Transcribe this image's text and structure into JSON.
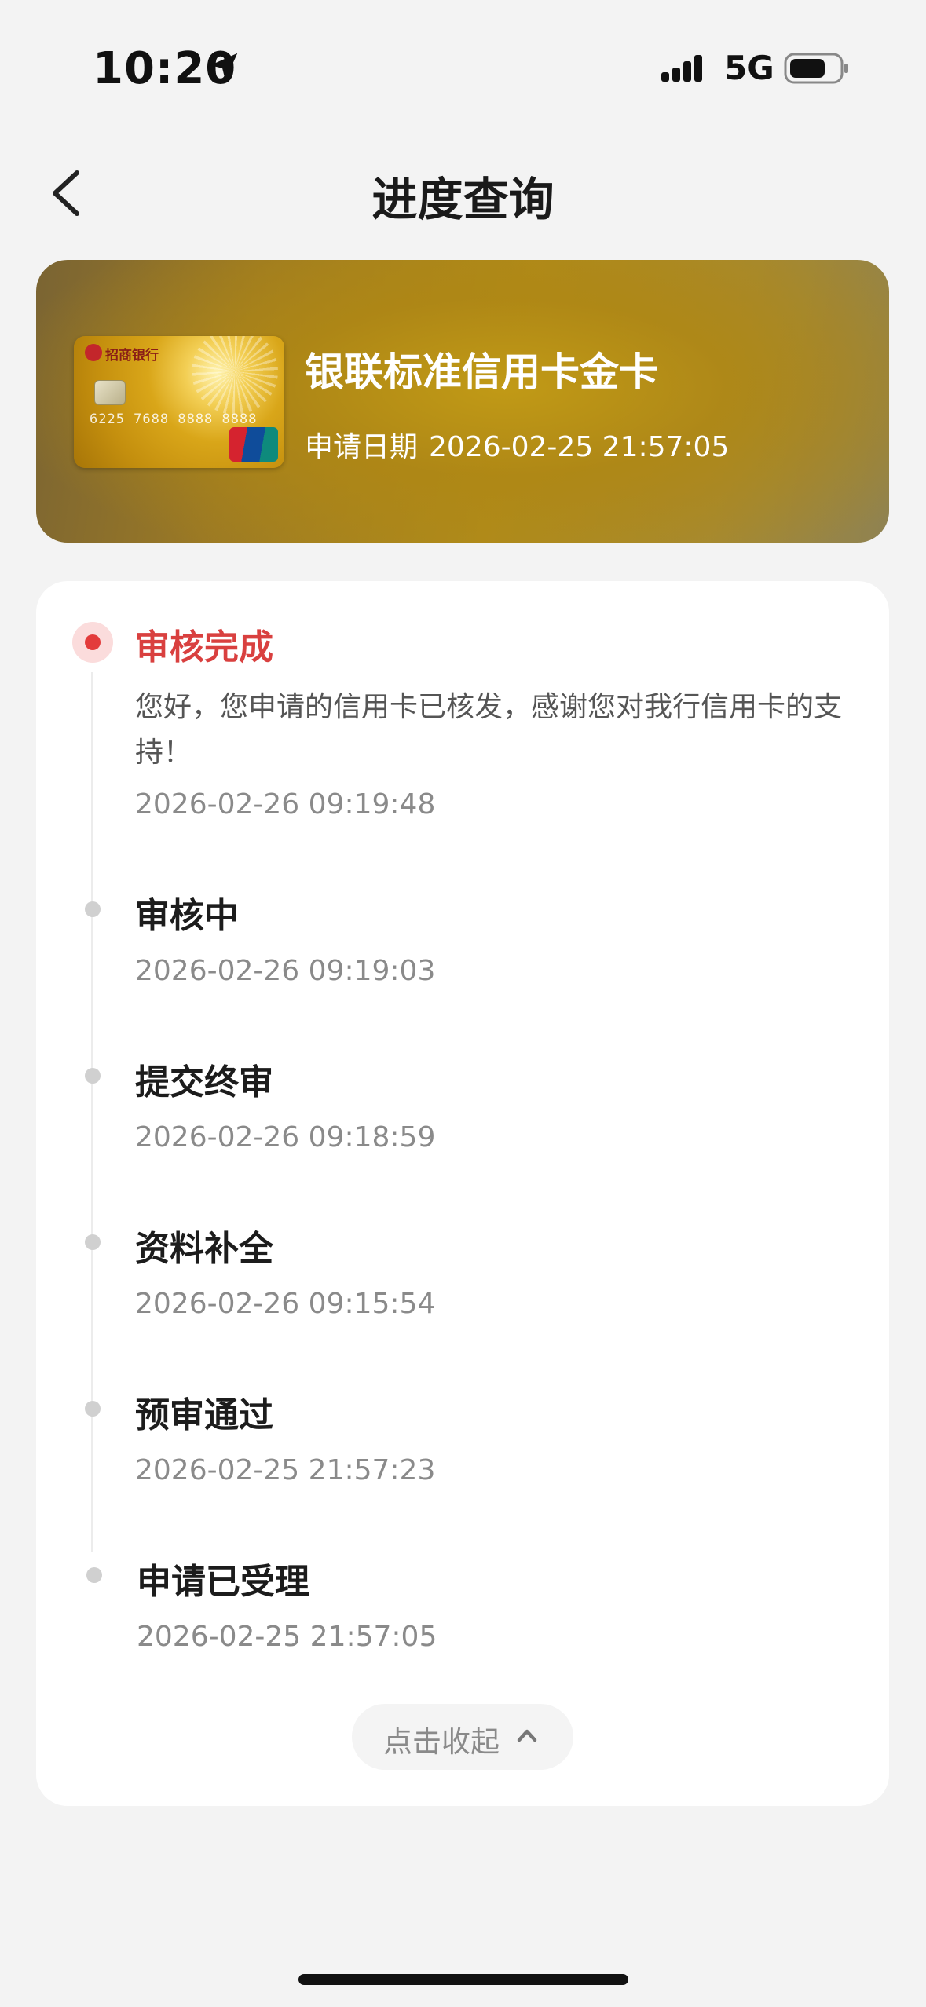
{
  "status_bar": {
    "time": "10:20",
    "network": "5G"
  },
  "header": {
    "title": "进度查询"
  },
  "card": {
    "name": "银联标准信用卡金卡",
    "apply_date_label": "申请日期",
    "apply_date": "2026-02-25 21:57:05",
    "thumbnail": {
      "bank_text": "招商银行",
      "card_number": "6225 7688 8888 8888"
    }
  },
  "progress": {
    "steps": [
      {
        "title": "审核完成",
        "description": "您好，您申请的信用卡已核发，感谢您对我行信用卡的支持！",
        "time": "2026-02-26 09:19:48",
        "active": true
      },
      {
        "title": "审核中",
        "time": "2026-02-26 09:19:03"
      },
      {
        "title": "提交终审",
        "time": "2026-02-26 09:18:59"
      },
      {
        "title": "资料补全",
        "time": "2026-02-26 09:15:54"
      },
      {
        "title": "预审通过",
        "time": "2026-02-25 21:57:23"
      },
      {
        "title": "申请已受理",
        "time": "2026-02-25 21:57:05"
      }
    ],
    "collapse_label": "点击收起"
  },
  "colors": {
    "active": "#d9403f",
    "background": "#f3f3f3",
    "panel": "#ffffff"
  }
}
